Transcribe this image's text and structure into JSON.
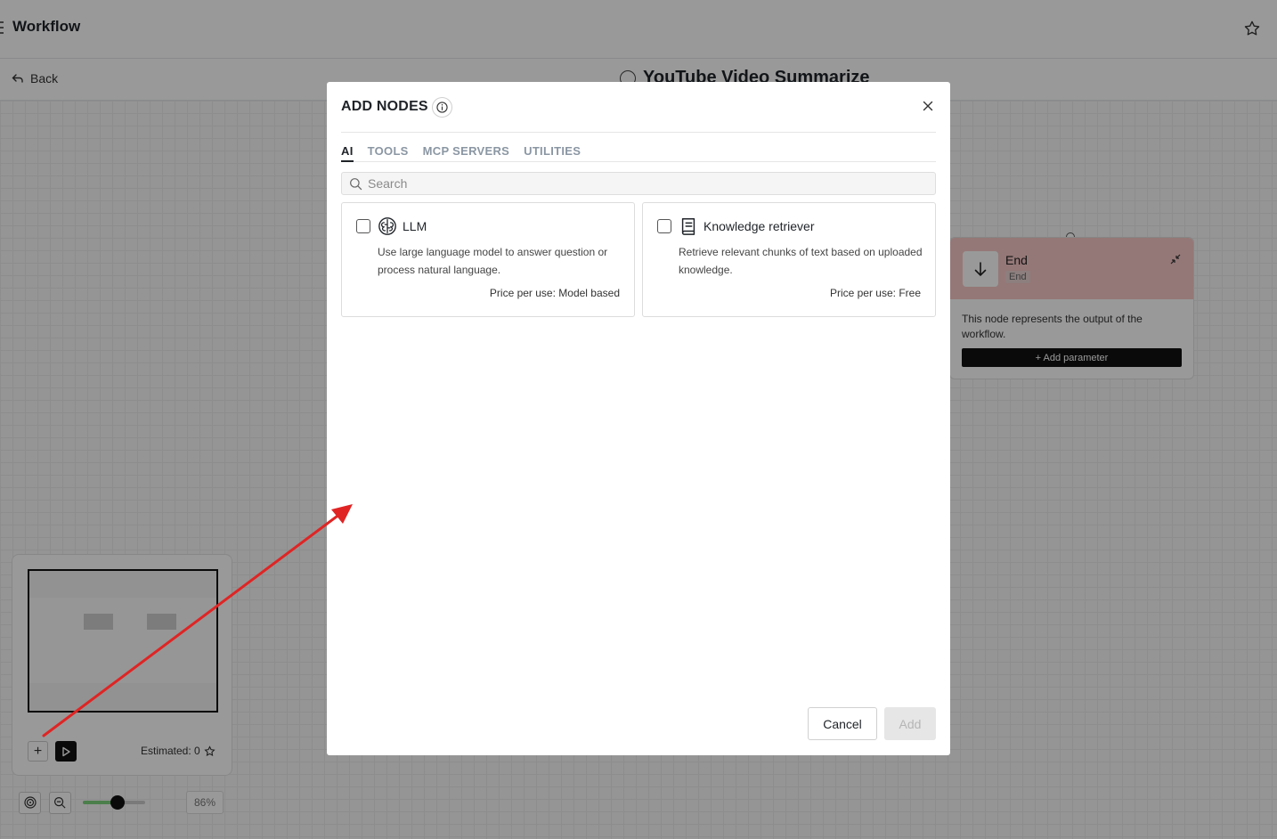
{
  "app": {
    "title": "Workflow"
  },
  "subbar": {
    "back_label": "Back",
    "workflow_name": "YouTube Video Summarize"
  },
  "end_node": {
    "title": "End",
    "subtitle": "End",
    "description": "This node represents the output of the workflow.",
    "add_parameter_label": "+ Add parameter"
  },
  "minimap": {
    "estimated_label": "Estimated: 0"
  },
  "zoom": {
    "percent": "86%",
    "level": 0.55
  },
  "modal": {
    "title": "ADD NODES",
    "tabs": [
      {
        "label": "AI",
        "active": true
      },
      {
        "label": "TOOLS",
        "active": false
      },
      {
        "label": "MCP SERVERS",
        "active": false
      },
      {
        "label": "UTILITIES",
        "active": false
      }
    ],
    "search_placeholder": "Search",
    "cards": [
      {
        "name": "LLM",
        "icon": "brain-icon",
        "description": "Use large language model to answer question or process natural language.",
        "price": "Price per use: Model based",
        "checked": false
      },
      {
        "name": "Knowledge retriever",
        "icon": "book-icon",
        "description": "Retrieve relevant chunks of text based on uploaded knowledge.",
        "price": "Price per use: Free",
        "checked": false
      }
    ],
    "cancel_label": "Cancel",
    "add_label": "Add"
  },
  "colors": {
    "end_node_header": "#f7c9c6",
    "annotation_arrow": "#e02424",
    "zoom_fill": "#7ed37e"
  }
}
